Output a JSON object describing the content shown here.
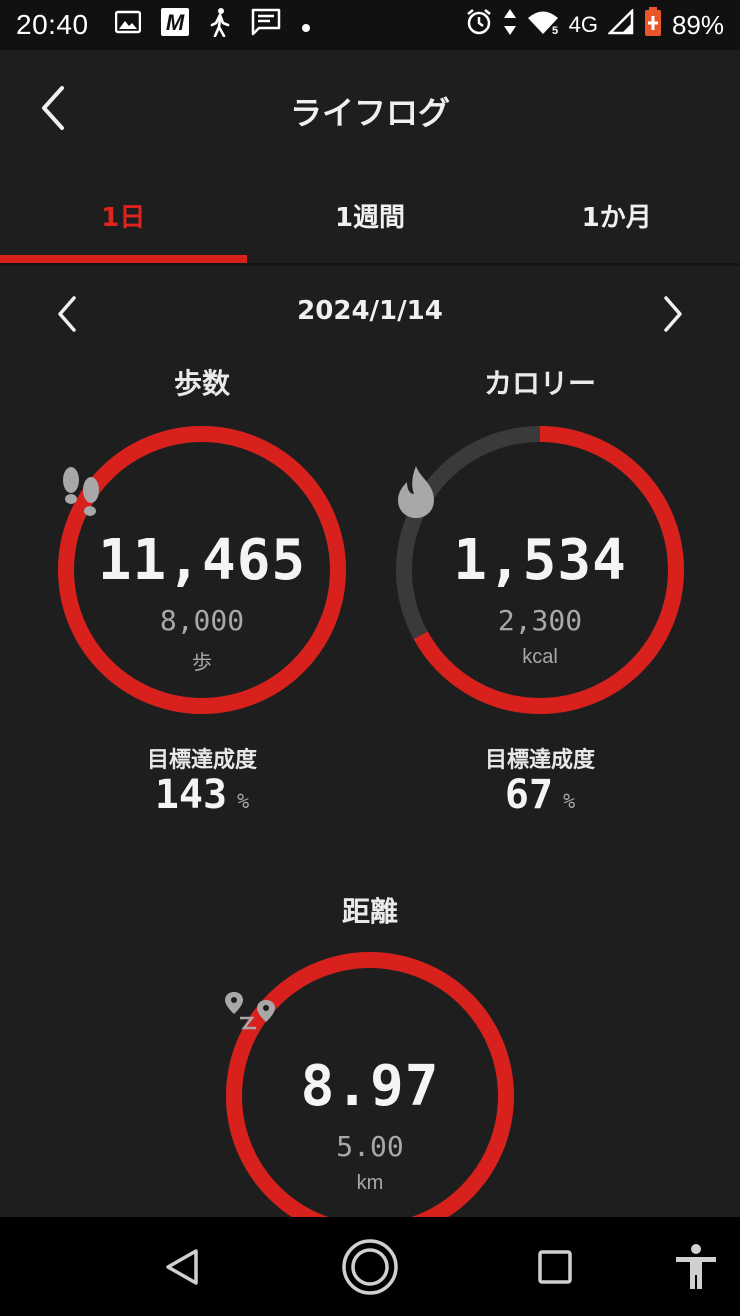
{
  "status_bar": {
    "time": "20:40",
    "network": "4G",
    "battery": "89%",
    "icons_left": [
      "image-icon",
      "m-app-icon",
      "walking-icon",
      "message-icon",
      "dot-icon"
    ],
    "icons_right": [
      "alarm-icon",
      "data-arrows-icon",
      "wifi-icon",
      "signal-icon",
      "battery-icon"
    ]
  },
  "header": {
    "title": "ライフログ"
  },
  "tabs": [
    {
      "label": "1日",
      "active": true
    },
    {
      "label": "1週間",
      "active": false
    },
    {
      "label": "1か月",
      "active": false
    }
  ],
  "date_nav": {
    "date": "2024/1/14"
  },
  "steps": {
    "title": "歩数",
    "value": "11,465",
    "target": "8,000",
    "unit": "歩",
    "achievement_label": "目標達成度",
    "achievement_value": "143",
    "achievement_unit": "%",
    "progress": 1.0,
    "icon": "footprints-icon"
  },
  "calories": {
    "title": "カロリー",
    "value": "1,534",
    "target": "2,300",
    "unit": "kcal",
    "achievement_label": "目標達成度",
    "achievement_value": "67",
    "achievement_unit": "%",
    "progress": 0.67,
    "icon": "flame-icon"
  },
  "distance": {
    "title": "距離",
    "value": "8.97",
    "target": "5.00",
    "unit": "km",
    "progress": 1.0,
    "icon": "route-icon"
  },
  "colors": {
    "accent": "#d8201c",
    "ring_track": "#3a3a3a",
    "background": "#1e1e1e"
  }
}
